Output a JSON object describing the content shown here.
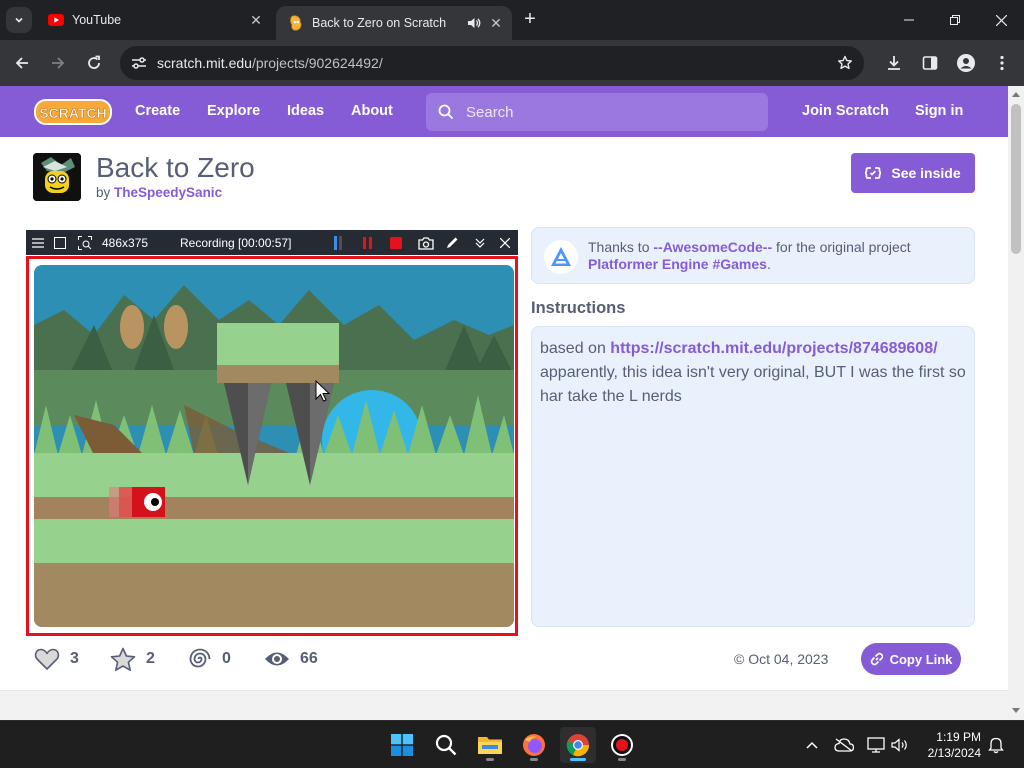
{
  "browser": {
    "tabs": [
      {
        "title": "YouTube",
        "active": false
      },
      {
        "title": "Back to Zero on Scratch",
        "active": true,
        "audio": true
      }
    ],
    "url_host": "scratch.mit.edu",
    "url_path": "/projects/902624492/"
  },
  "nav": {
    "logo_text": "SCRATCH",
    "links": [
      "Create",
      "Explore",
      "Ideas",
      "About"
    ],
    "search_placeholder": "Search",
    "join": "Join Scratch",
    "signin": "Sign in",
    "color": "#855cd6"
  },
  "project": {
    "title": "Back to Zero",
    "by_prefix": "by",
    "author": "TheSpeedySanic",
    "see_inside": "See inside"
  },
  "recording": {
    "size": "486x375",
    "status": "Recording [00:00:57]"
  },
  "remix": {
    "prefix": "Thanks to",
    "user": "--AwesomeCode--",
    "middle": "for the original project",
    "project": "Platformer Engine #Games",
    "suffix": "."
  },
  "instructions": {
    "heading": "Instructions",
    "prefix": "based on",
    "link": "https://scratch.mit.edu/projects/874689608/",
    "text": "apparently, this idea isn't very original, BUT I was the first so har take the L nerds"
  },
  "stats": {
    "loves": "3",
    "favorites": "2",
    "remixes": "0",
    "views": "66",
    "date": "Oct 04, 2023",
    "copy_link": "Copy Link"
  },
  "taskbar": {
    "time": "1:19 PM",
    "date": "2/13/2024",
    "apps": [
      "windows-start",
      "search",
      "file-explorer",
      "firefox",
      "chrome",
      "recorder"
    ]
  }
}
